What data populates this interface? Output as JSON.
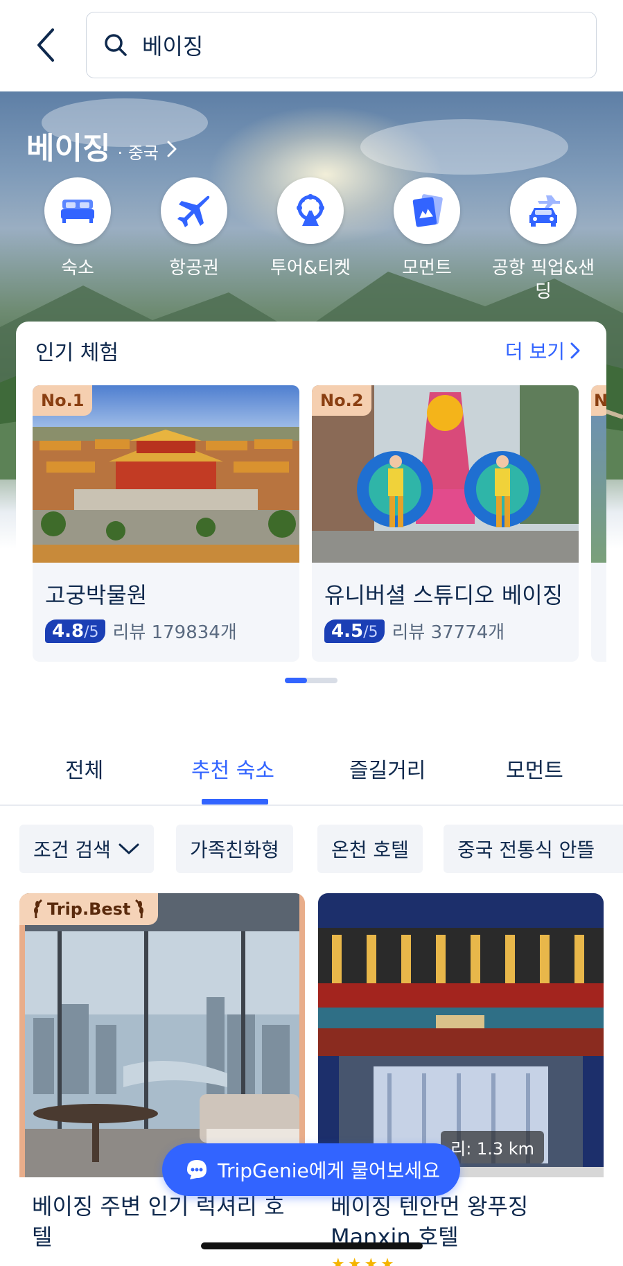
{
  "search": {
    "query": "베이징"
  },
  "hero": {
    "city": "베이징",
    "country": "· 중국",
    "quick_links": [
      {
        "label": "숙소",
        "icon": "bed-icon"
      },
      {
        "label": "항공권",
        "icon": "airplane-icon"
      },
      {
        "label": "투어&티켓",
        "icon": "ferris-wheel-icon"
      },
      {
        "label": "모먼트",
        "icon": "moments-icon"
      },
      {
        "label": "공항 픽업&샌\n딩",
        "icon": "airport-car-icon"
      }
    ]
  },
  "popular": {
    "title": "인기 체험",
    "more": "더 보기",
    "items": [
      {
        "rank": "No.1",
        "name": "고궁박물원",
        "rating": "4.8",
        "rating_max": "/5",
        "reviews": "리뷰 179834개"
      },
      {
        "rank": "No.2",
        "name": "유니버셜 스튜디오 베이징",
        "rating": "4.5",
        "rating_max": "/5",
        "reviews": "리뷰 37774개"
      },
      {
        "rank": "N"
      }
    ]
  },
  "tabs": [
    {
      "label": "전체"
    },
    {
      "label": "추천 숙소"
    },
    {
      "label": "즐길거리"
    },
    {
      "label": "모먼트"
    }
  ],
  "filters": [
    "조건 검색",
    "가족친화형",
    "온천 호텔",
    "중국 전통식 안뜰"
  ],
  "hotels": [
    {
      "badge": "Trip.Best",
      "name": "베이징 주변 인기 럭셔리 호\n텔"
    },
    {
      "distance": "리: 1.3 km",
      "name": "베이징 텐안먼 왕푸징\nManxin 호텔"
    }
  ],
  "assistant": {
    "label": "TripGenie에게 물어보세요"
  },
  "colors": {
    "accent": "#3264ff",
    "text": "#0f294d",
    "rating": "#1b3fb5"
  }
}
